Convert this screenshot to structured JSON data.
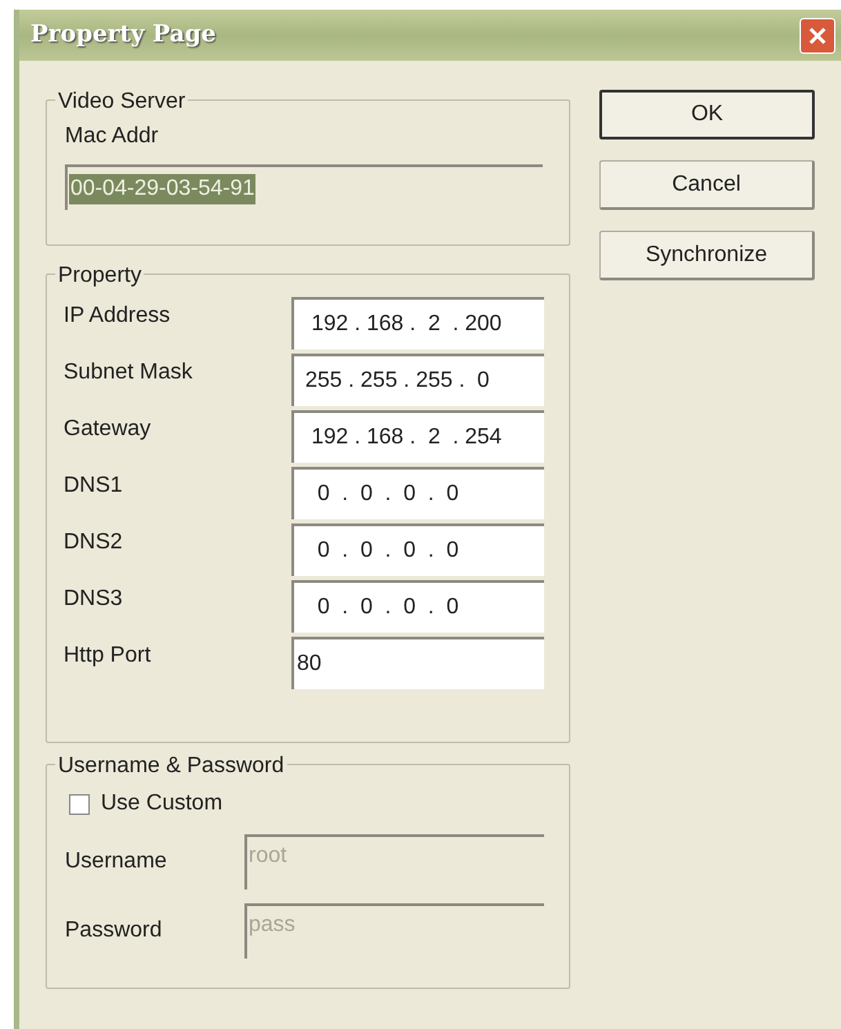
{
  "window": {
    "title": "Property Page"
  },
  "video_server": {
    "title": "Video Server",
    "mac_label": "Mac Addr",
    "mac_value": "00-04-29-03-54-91",
    "mac_selected": true
  },
  "property": {
    "title": "Property",
    "fields": [
      {
        "label": "IP Address",
        "value": " 192 . 168 .  2  . 200",
        "kind": "ip"
      },
      {
        "label": "Subnet Mask",
        "value": "255 . 255 . 255 .  0",
        "kind": "ip"
      },
      {
        "label": "Gateway",
        "value": " 192 . 168 .  2  . 254",
        "kind": "ip"
      },
      {
        "label": "DNS1",
        "value": "  0  .  0  .  0  .  0",
        "kind": "ip"
      },
      {
        "label": "DNS2",
        "value": "  0  .  0  .  0  .  0",
        "kind": "ip"
      },
      {
        "label": "DNS3",
        "value": "  0  .  0  .  0  .  0",
        "kind": "ip"
      },
      {
        "label": "Http Port",
        "value": "80",
        "kind": "text"
      }
    ]
  },
  "credentials": {
    "title": "Username & Password",
    "use_custom": {
      "label": "Use Custom",
      "checked": false
    },
    "fields": [
      {
        "label": "Username",
        "value": "root",
        "disabled": true
      },
      {
        "label": "Password",
        "value": "pass",
        "disabled": true
      }
    ]
  },
  "buttons": [
    {
      "label": "OK",
      "default": true
    },
    {
      "label": "Cancel",
      "default": false
    },
    {
      "label": "Synchronize",
      "default": false
    }
  ]
}
